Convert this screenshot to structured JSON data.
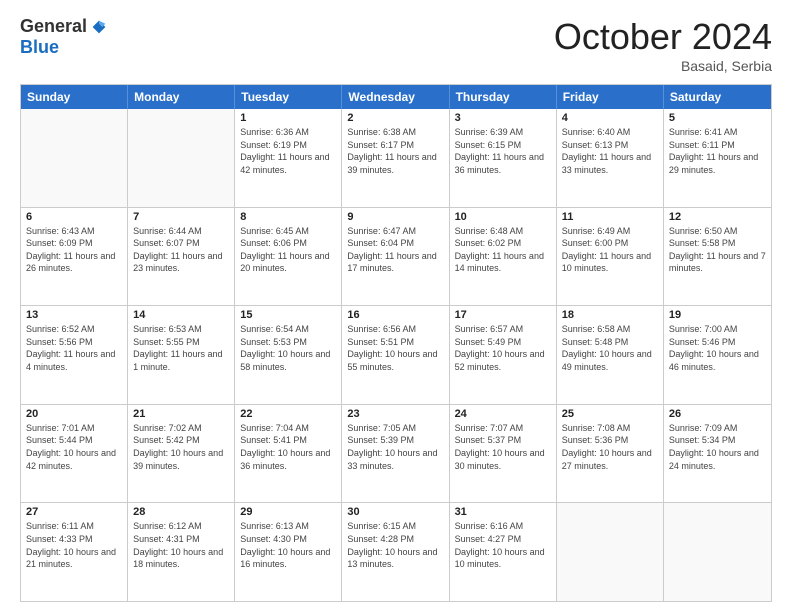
{
  "logo": {
    "general": "General",
    "blue": "Blue"
  },
  "header": {
    "month": "October 2024",
    "location": "Basaid, Serbia"
  },
  "weekdays": [
    "Sunday",
    "Monday",
    "Tuesday",
    "Wednesday",
    "Thursday",
    "Friday",
    "Saturday"
  ],
  "weeks": [
    [
      {
        "day": "",
        "sunrise": "",
        "sunset": "",
        "daylight": ""
      },
      {
        "day": "",
        "sunrise": "",
        "sunset": "",
        "daylight": ""
      },
      {
        "day": "1",
        "sunrise": "Sunrise: 6:36 AM",
        "sunset": "Sunset: 6:19 PM",
        "daylight": "Daylight: 11 hours and 42 minutes."
      },
      {
        "day": "2",
        "sunrise": "Sunrise: 6:38 AM",
        "sunset": "Sunset: 6:17 PM",
        "daylight": "Daylight: 11 hours and 39 minutes."
      },
      {
        "day": "3",
        "sunrise": "Sunrise: 6:39 AM",
        "sunset": "Sunset: 6:15 PM",
        "daylight": "Daylight: 11 hours and 36 minutes."
      },
      {
        "day": "4",
        "sunrise": "Sunrise: 6:40 AM",
        "sunset": "Sunset: 6:13 PM",
        "daylight": "Daylight: 11 hours and 33 minutes."
      },
      {
        "day": "5",
        "sunrise": "Sunrise: 6:41 AM",
        "sunset": "Sunset: 6:11 PM",
        "daylight": "Daylight: 11 hours and 29 minutes."
      }
    ],
    [
      {
        "day": "6",
        "sunrise": "Sunrise: 6:43 AM",
        "sunset": "Sunset: 6:09 PM",
        "daylight": "Daylight: 11 hours and 26 minutes."
      },
      {
        "day": "7",
        "sunrise": "Sunrise: 6:44 AM",
        "sunset": "Sunset: 6:07 PM",
        "daylight": "Daylight: 11 hours and 23 minutes."
      },
      {
        "day": "8",
        "sunrise": "Sunrise: 6:45 AM",
        "sunset": "Sunset: 6:06 PM",
        "daylight": "Daylight: 11 hours and 20 minutes."
      },
      {
        "day": "9",
        "sunrise": "Sunrise: 6:47 AM",
        "sunset": "Sunset: 6:04 PM",
        "daylight": "Daylight: 11 hours and 17 minutes."
      },
      {
        "day": "10",
        "sunrise": "Sunrise: 6:48 AM",
        "sunset": "Sunset: 6:02 PM",
        "daylight": "Daylight: 11 hours and 14 minutes."
      },
      {
        "day": "11",
        "sunrise": "Sunrise: 6:49 AM",
        "sunset": "Sunset: 6:00 PM",
        "daylight": "Daylight: 11 hours and 10 minutes."
      },
      {
        "day": "12",
        "sunrise": "Sunrise: 6:50 AM",
        "sunset": "Sunset: 5:58 PM",
        "daylight": "Daylight: 11 hours and 7 minutes."
      }
    ],
    [
      {
        "day": "13",
        "sunrise": "Sunrise: 6:52 AM",
        "sunset": "Sunset: 5:56 PM",
        "daylight": "Daylight: 11 hours and 4 minutes."
      },
      {
        "day": "14",
        "sunrise": "Sunrise: 6:53 AM",
        "sunset": "Sunset: 5:55 PM",
        "daylight": "Daylight: 11 hours and 1 minute."
      },
      {
        "day": "15",
        "sunrise": "Sunrise: 6:54 AM",
        "sunset": "Sunset: 5:53 PM",
        "daylight": "Daylight: 10 hours and 58 minutes."
      },
      {
        "day": "16",
        "sunrise": "Sunrise: 6:56 AM",
        "sunset": "Sunset: 5:51 PM",
        "daylight": "Daylight: 10 hours and 55 minutes."
      },
      {
        "day": "17",
        "sunrise": "Sunrise: 6:57 AM",
        "sunset": "Sunset: 5:49 PM",
        "daylight": "Daylight: 10 hours and 52 minutes."
      },
      {
        "day": "18",
        "sunrise": "Sunrise: 6:58 AM",
        "sunset": "Sunset: 5:48 PM",
        "daylight": "Daylight: 10 hours and 49 minutes."
      },
      {
        "day": "19",
        "sunrise": "Sunrise: 7:00 AM",
        "sunset": "Sunset: 5:46 PM",
        "daylight": "Daylight: 10 hours and 46 minutes."
      }
    ],
    [
      {
        "day": "20",
        "sunrise": "Sunrise: 7:01 AM",
        "sunset": "Sunset: 5:44 PM",
        "daylight": "Daylight: 10 hours and 42 minutes."
      },
      {
        "day": "21",
        "sunrise": "Sunrise: 7:02 AM",
        "sunset": "Sunset: 5:42 PM",
        "daylight": "Daylight: 10 hours and 39 minutes."
      },
      {
        "day": "22",
        "sunrise": "Sunrise: 7:04 AM",
        "sunset": "Sunset: 5:41 PM",
        "daylight": "Daylight: 10 hours and 36 minutes."
      },
      {
        "day": "23",
        "sunrise": "Sunrise: 7:05 AM",
        "sunset": "Sunset: 5:39 PM",
        "daylight": "Daylight: 10 hours and 33 minutes."
      },
      {
        "day": "24",
        "sunrise": "Sunrise: 7:07 AM",
        "sunset": "Sunset: 5:37 PM",
        "daylight": "Daylight: 10 hours and 30 minutes."
      },
      {
        "day": "25",
        "sunrise": "Sunrise: 7:08 AM",
        "sunset": "Sunset: 5:36 PM",
        "daylight": "Daylight: 10 hours and 27 minutes."
      },
      {
        "day": "26",
        "sunrise": "Sunrise: 7:09 AM",
        "sunset": "Sunset: 5:34 PM",
        "daylight": "Daylight: 10 hours and 24 minutes."
      }
    ],
    [
      {
        "day": "27",
        "sunrise": "Sunrise: 6:11 AM",
        "sunset": "Sunset: 4:33 PM",
        "daylight": "Daylight: 10 hours and 21 minutes."
      },
      {
        "day": "28",
        "sunrise": "Sunrise: 6:12 AM",
        "sunset": "Sunset: 4:31 PM",
        "daylight": "Daylight: 10 hours and 18 minutes."
      },
      {
        "day": "29",
        "sunrise": "Sunrise: 6:13 AM",
        "sunset": "Sunset: 4:30 PM",
        "daylight": "Daylight: 10 hours and 16 minutes."
      },
      {
        "day": "30",
        "sunrise": "Sunrise: 6:15 AM",
        "sunset": "Sunset: 4:28 PM",
        "daylight": "Daylight: 10 hours and 13 minutes."
      },
      {
        "day": "31",
        "sunrise": "Sunrise: 6:16 AM",
        "sunset": "Sunset: 4:27 PM",
        "daylight": "Daylight: 10 hours and 10 minutes."
      },
      {
        "day": "",
        "sunrise": "",
        "sunset": "",
        "daylight": ""
      },
      {
        "day": "",
        "sunrise": "",
        "sunset": "",
        "daylight": ""
      }
    ]
  ]
}
